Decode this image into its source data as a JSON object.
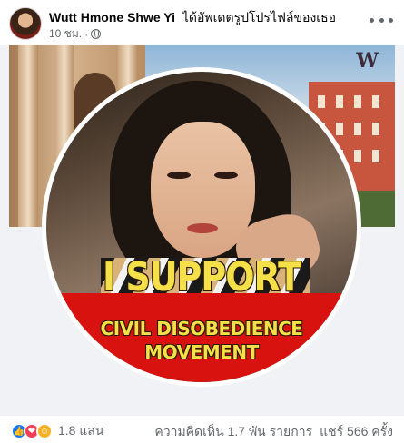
{
  "post": {
    "author": "Wutt Hmone Shwe Yi",
    "action": "ได้อัพเดตรูปโปรไฟล์ของเธอ",
    "time": "10 ชม.",
    "separator": "·",
    "audience_icon": "globe-icon",
    "more_icon": "more-options-icon"
  },
  "photo": {
    "headline": "I SUPPORT",
    "subline_1": "CIVIL DISOBEDIENCE",
    "subline_2": "MOVEMENT",
    "logo": "W",
    "banner_color": "#d8130f",
    "text_color": "#f6e04a"
  },
  "footer": {
    "reaction_icons": [
      "like-icon",
      "love-icon",
      "care-icon"
    ],
    "reaction_count": "1.8 แสน",
    "comments": "ความคิดเห็น 1.7 พัน รายการ",
    "shares": "แชร์ 566 ครั้ง"
  }
}
